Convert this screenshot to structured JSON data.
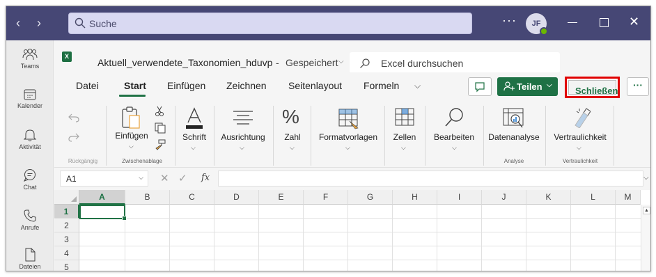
{
  "titlebar": {
    "search_placeholder": "Suche",
    "more": "···",
    "avatar_initials": "JF"
  },
  "rail": {
    "items": [
      {
        "label": "Teams",
        "icon": "teams-icon"
      },
      {
        "label": "Kalender",
        "icon": "calendar-icon"
      },
      {
        "label": "Aktivität",
        "icon": "bell-icon"
      },
      {
        "label": "Chat",
        "icon": "chat-icon"
      },
      {
        "label": "Anrufe",
        "icon": "phone-icon"
      },
      {
        "label": "Dateien",
        "icon": "file-icon"
      }
    ]
  },
  "excel": {
    "logo": "X",
    "doc_title": "Aktuell_verwendete_Taxonomien_hduvp",
    "separator": "-",
    "status": "Gespeichert",
    "search_placeholder": "Excel durchsuchen"
  },
  "tabs": [
    {
      "label": "Datei"
    },
    {
      "label": "Start"
    },
    {
      "label": "Einfügen"
    },
    {
      "label": "Zeichnen"
    },
    {
      "label": "Seitenlayout"
    },
    {
      "label": "Formeln"
    }
  ],
  "actions": {
    "share": "Teilen",
    "close": "Schließen",
    "more": "···"
  },
  "ribbon": {
    "paste": "Einfügen",
    "font": "Schrift",
    "alignment": "Ausrichtung",
    "number": "Zahl",
    "styles": "Formatvorlagen",
    "cells": "Zellen",
    "editing": "Bearbeiten",
    "analyze": "Datenanalyse",
    "sensitivity": "Vertraulichkeit",
    "groups": {
      "undo": "Rückgängig",
      "clipboard": "Zwischenablage",
      "analysis": "Analyse",
      "sensitivity": "Vertraulichkeit"
    }
  },
  "formula_bar": {
    "name_box": "A1",
    "fx": "fx",
    "cancel": "✕",
    "enter": "✓"
  },
  "sheet": {
    "columns": [
      "A",
      "B",
      "C",
      "D",
      "E",
      "F",
      "G",
      "H",
      "I",
      "J",
      "K",
      "L",
      "M"
    ],
    "rows": [
      "1",
      "2",
      "3",
      "4",
      "5"
    ],
    "selected": "A1"
  },
  "colors": {
    "teams_purple": "#464775",
    "excel_green": "#217346",
    "highlight_red": "#e00000"
  }
}
